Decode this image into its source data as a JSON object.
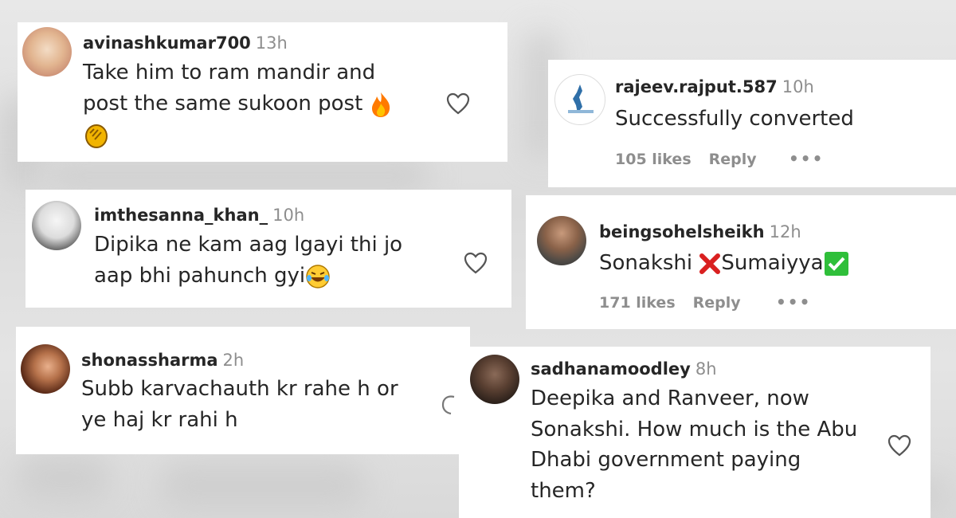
{
  "comments": [
    {
      "username": "avinashkumar700",
      "time": "13h",
      "line1": "Take him to ram mandir and",
      "line2": "post the same sukoon post",
      "emoji_end": "fire-emoji",
      "line3_emoji": "clapping-hands-emoji"
    },
    {
      "username": "rajeev.rajput.587",
      "time": "10h",
      "text": "Successfully converted",
      "likes": "105 likes",
      "reply": "Reply",
      "more": "•••"
    },
    {
      "username": "imthesanna_khan_",
      "time": "10h",
      "line1": "Dipika ne kam aag lgayi thi jo",
      "line2": "aap bhi pahunch gyi",
      "emoji_end": "laughing-tears-emoji"
    },
    {
      "username": "beingsohelsheikh",
      "time": "12h",
      "word1": "Sonakshi",
      "word2": "Sumaiyya",
      "cross_emoji": "cross-mark-emoji",
      "check_emoji": "check-mark-emoji",
      "likes": "171 likes",
      "reply": "Reply",
      "more": "•••"
    },
    {
      "username": "shonassharma",
      "time": "2h",
      "line1": "Subb karvachauth kr rahe h or",
      "line2": "ye haj kr rahi h"
    },
    {
      "username": "sadhanamoodley",
      "time": "8h",
      "line1": "Deepika and Ranveer, now",
      "line2": "Sonakshi. How much is the Abu",
      "line3": "Dhabi government paying",
      "line4": "them?"
    }
  ],
  "colors": {
    "text": "#262626",
    "muted": "#8e8e8e",
    "fire": "#ff6a00",
    "check": "#2fbf3a",
    "cross": "#d92020"
  }
}
